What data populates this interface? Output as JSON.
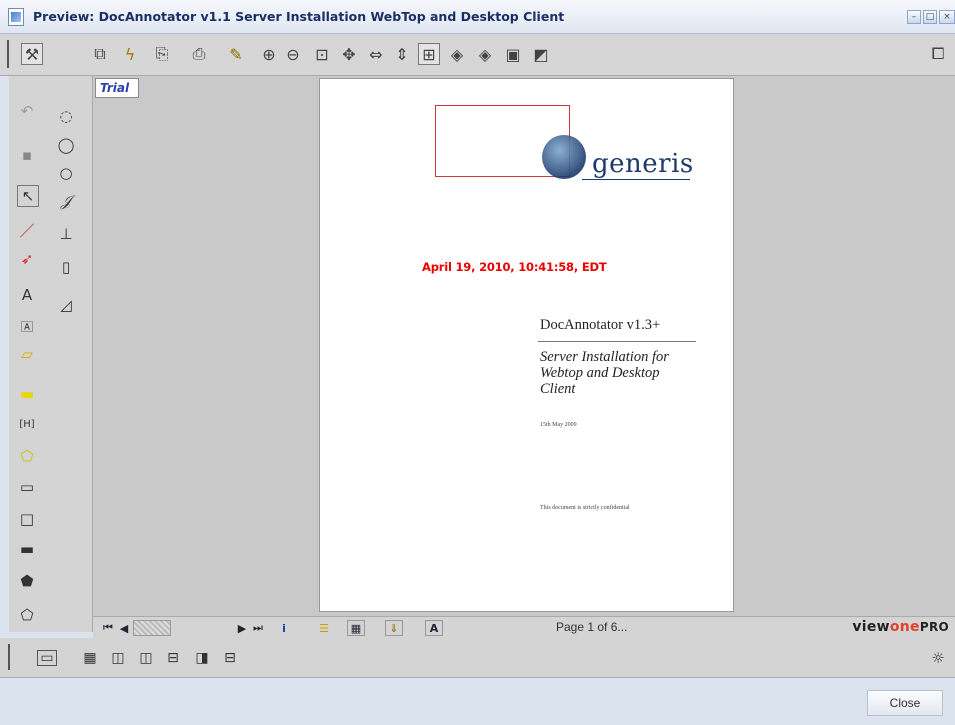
{
  "window": {
    "title": "Preview: DocAnnotator v1.1 Server Installation WebTop and Desktop Client"
  },
  "toolbar": {
    "icons": [
      "tools-icon",
      "open-icon",
      "lightning-icon",
      "save-page-icon",
      "print-icon",
      "highlight-select-icon",
      "zoom-in-icon",
      "zoom-out-icon",
      "zoom-rect-icon",
      "pan-icon",
      "fit-width-icon",
      "fit-height-icon",
      "fit-page-icon",
      "prev-annotation-icon",
      "next-annotation-icon",
      "page-export-icon",
      "invert-icon"
    ]
  },
  "badge": {
    "trial": "Trial"
  },
  "document": {
    "logo": "generis",
    "stamp": "April 19, 2010, 10:41:58, EDT",
    "title": "DocAnnotator v1.3+",
    "subtitle": "Server Installation for Webtop and Desktop Client",
    "date": "15th May 2009",
    "confidential": "This document is strictly confidential"
  },
  "nav": {
    "page_info": "Page 1 of 6...",
    "brand_view": "view",
    "brand_one": "one",
    "brand_pro": "PRO"
  },
  "footer": {
    "close_label": "Close"
  }
}
